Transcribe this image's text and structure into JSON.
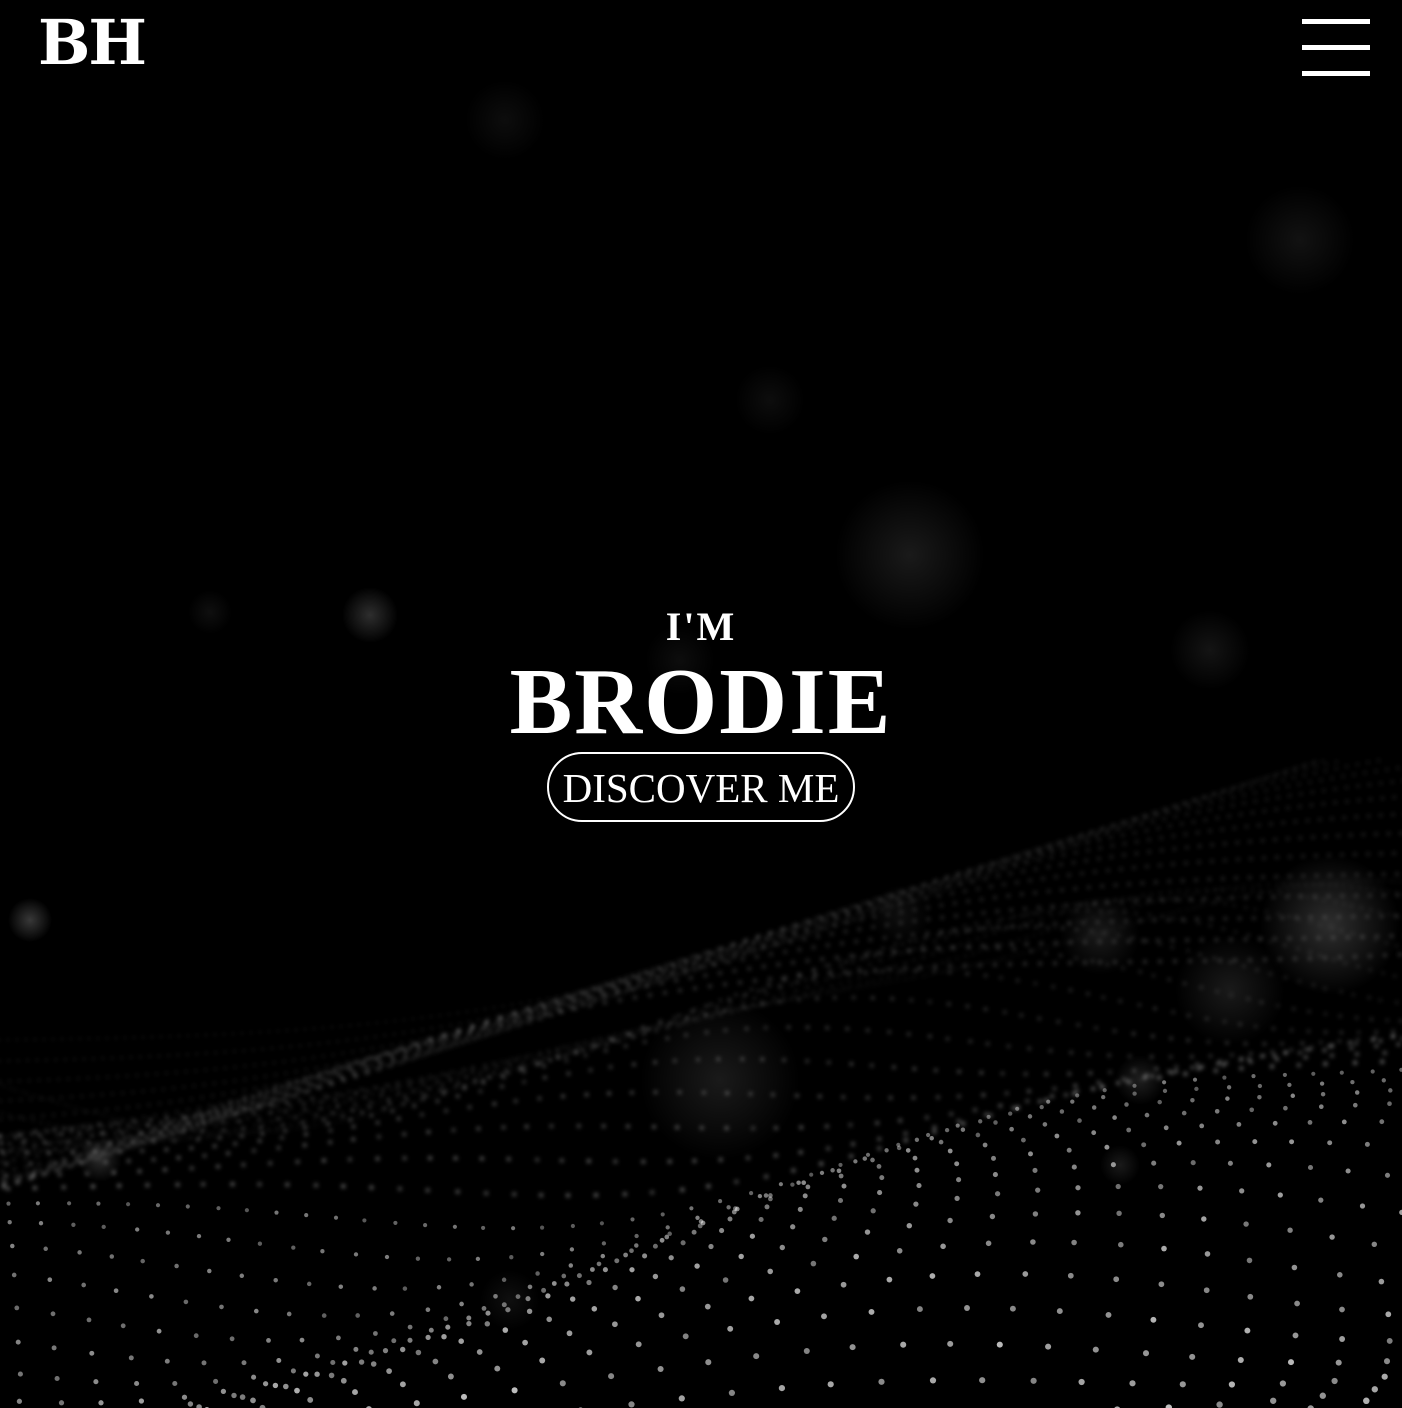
{
  "header": {
    "logo": "BH",
    "menu_icon": "hamburger-menu-icon"
  },
  "hero": {
    "eyebrow": "I'M",
    "name": "BRODIE",
    "cta_label": "DISCOVER ME"
  },
  "theme": {
    "background": "#000000",
    "foreground": "#ffffff"
  }
}
